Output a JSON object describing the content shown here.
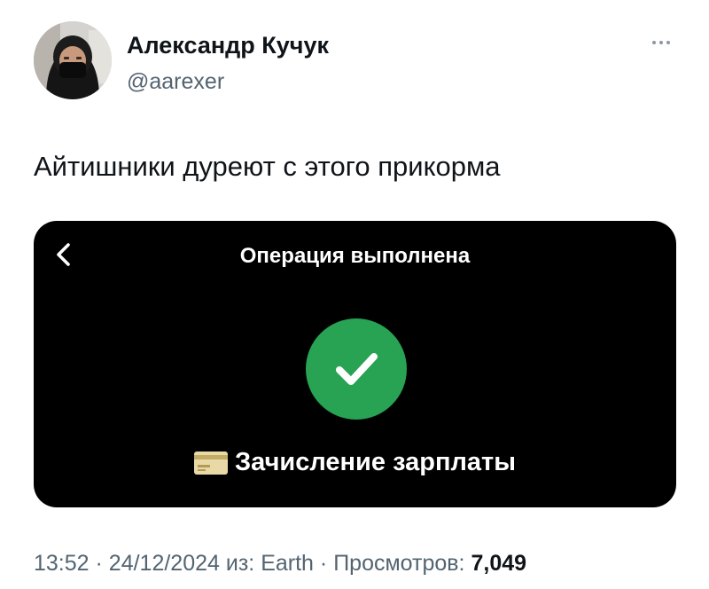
{
  "author": {
    "display_name": "Александр Кучук",
    "handle": "@aarexer"
  },
  "tweet": {
    "text": "Айтишники дуреют с этого прикорма"
  },
  "media": {
    "screen_title": "Операция выполнена",
    "payment_label": "Зачисление зарплаты",
    "success_color": "#27a353",
    "icons": [
      "chevron-left-icon",
      "checkmark-circle-icon",
      "credit-card-icon"
    ]
  },
  "meta": {
    "time": "13:52",
    "date": "24/12/2024",
    "source_prefix": "из:",
    "source": "Earth",
    "separator": "·",
    "views_label": "Просмотров:",
    "views_count": "7,049"
  }
}
